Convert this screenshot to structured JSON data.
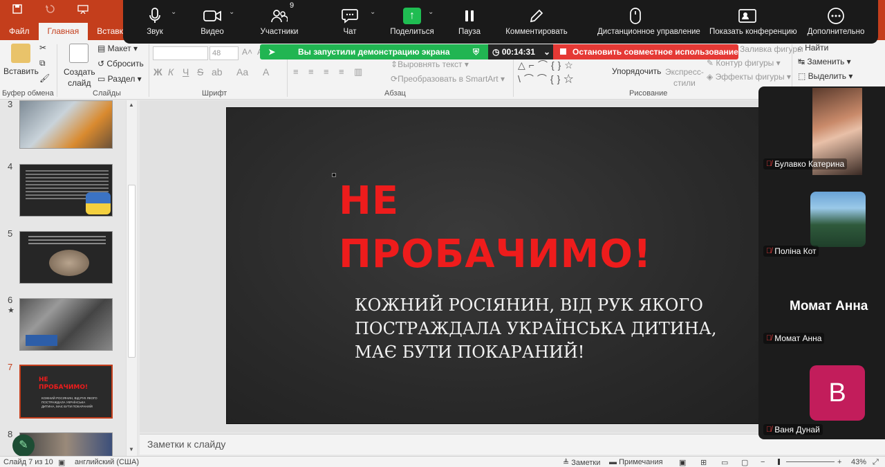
{
  "ppt": {
    "tabs": [
      "Файл",
      "Главная",
      "Вставка"
    ],
    "ribbon": {
      "paste_label": "Вставить",
      "new_slide_label": "Создать\nслайд",
      "layout_label": "Макет",
      "reset_label": "Сбросить",
      "section_label": "Раздел",
      "font_size": "48",
      "align_text_label": "Выровнять текст",
      "smartart_label": "Преобразовать в SmartArt",
      "arrange_label": "Упорядочить",
      "quick_styles_label": "Экспресс-\nстили",
      "shape_fill_label": "Заливка фигуры",
      "shape_outline_label": "Контур фигуры",
      "shape_effects_label": "Эффекты фигуры",
      "find_label": "Найти",
      "replace_label": "Заменить",
      "select_label": "Выделить",
      "groups": [
        "Буфер обмена",
        "Слайды",
        "Шрифт",
        "Абзац",
        "Рисование"
      ]
    },
    "thumb_numbers": [
      "3",
      "4",
      "5",
      "6",
      "7",
      "8"
    ],
    "thumb7": {
      "title_l1": "НЕ",
      "title_l2": "ПРОБАЧИМО!",
      "body": "КОЖНИЙ РОСІЯНИН, ВІД РУК ЯКОГО ПОСТРАЖДАЛА УКРАЇНСЬКА ДИТИНА, МАЄ БУТИ ПОКАРАНИЙ!"
    },
    "slide": {
      "title_line1": "НЕ",
      "title_line2": "ПРОБАЧИМО!",
      "body_line1": "КОЖНИЙ РОСІЯНИН, ВІД РУК ЯКОГО",
      "body_line2": "ПОСТРАЖДАЛА УКРАЇНСЬКА ДИТИНА,",
      "body_line3": "МАЄ БУТИ ПОКАРАНИЙ!"
    },
    "notes_placeholder": "Заметки к слайду",
    "status": {
      "slide_counter": "Слайд 7 из 10",
      "language": "английский (США)",
      "notes_label": "Заметки",
      "comments_label": "Примечания",
      "zoom": "43%"
    }
  },
  "zoom": {
    "buttons": {
      "audio": "Звук",
      "video": "Видео",
      "participants": "Участники",
      "participants_count": "9",
      "chat": "Чат",
      "share": "Поделиться",
      "pause": "Пауза",
      "annotate": "Комментировать",
      "remote_control": "Дистанционное управление",
      "show_meeting": "Показать конференцию",
      "more": "Дополнительно"
    },
    "banner_text": "Вы запустили демонстрацию экрана",
    "timer": "00:14:31",
    "stop_text": "Остановить совместное использование",
    "participants": [
      {
        "name": "Булавко Катерина"
      },
      {
        "name": "Поліна Кот"
      },
      {
        "name": "Момат Анна",
        "display_name": "Момат Анна"
      },
      {
        "name": "Ваня Дунай",
        "initial": "В"
      }
    ]
  }
}
